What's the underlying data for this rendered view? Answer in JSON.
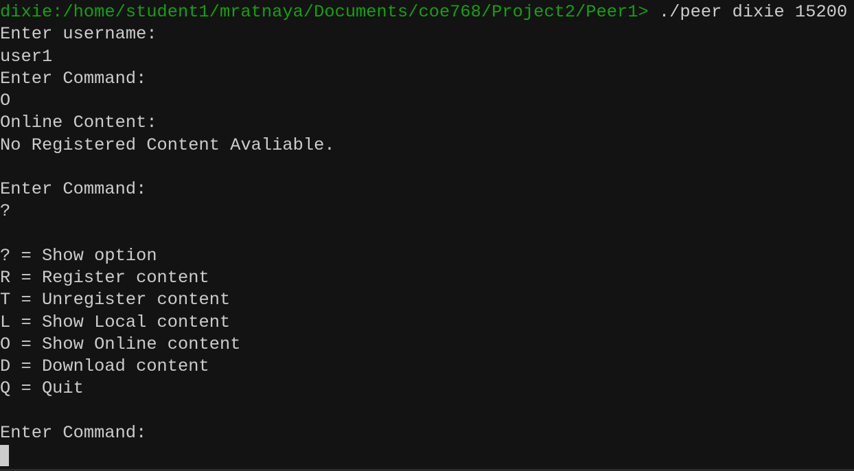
{
  "terminal": {
    "prompt": "dixie:/home/student1/mratnaya/Documents/coe768/Project2/Peer1>",
    "command": " ./peer dixie 15200",
    "lines": [
      "Enter username:",
      "user1",
      "Enter Command:",
      "O",
      "Online Content:",
      "No Registered Content Avaliable.",
      "",
      "Enter Command:",
      "?",
      "",
      "? = Show option",
      "R = Register content",
      "T = Unregister content",
      "L = Show Local content",
      "O = Show Online content",
      "D = Download content",
      "Q = Quit",
      "",
      "Enter Command:"
    ],
    "colors": {
      "background": "#131313",
      "text": "#cccccc",
      "prompt": "#13a10e"
    }
  }
}
